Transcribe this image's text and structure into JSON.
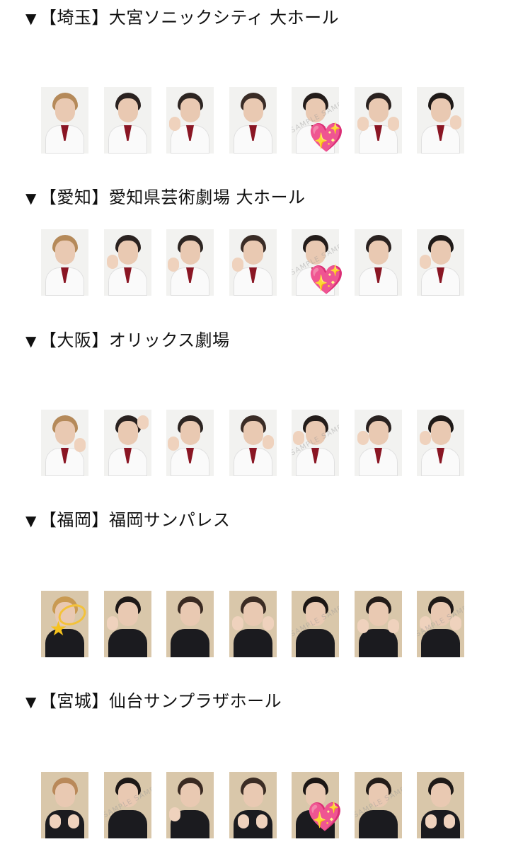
{
  "sections": [
    {
      "prefix": "▼",
      "label": "【埼玉】大宮ソニックシティ 大ホール",
      "theme": "white"
    },
    {
      "prefix": "▼",
      "label": "【愛知】愛知県芸術劇場 大ホール",
      "theme": "white"
    },
    {
      "prefix": "▼",
      "label": "【大阪】オリックス劇場",
      "theme": "white"
    },
    {
      "prefix": "▼",
      "label": "【福岡】福岡サンパレス",
      "theme": "dark"
    },
    {
      "prefix": "▼",
      "label": "【宮城】仙台サンプラザホール",
      "theme": "dark"
    }
  ],
  "watermark": "SAMPLE SAMPLE",
  "stickers": {
    "heart": "💖",
    "star": "★"
  },
  "colors": {
    "collar": "#8a1624",
    "dark_bg": "#d9c7aa",
    "heart": "#ff5fa8",
    "star": "#f6c21c"
  }
}
